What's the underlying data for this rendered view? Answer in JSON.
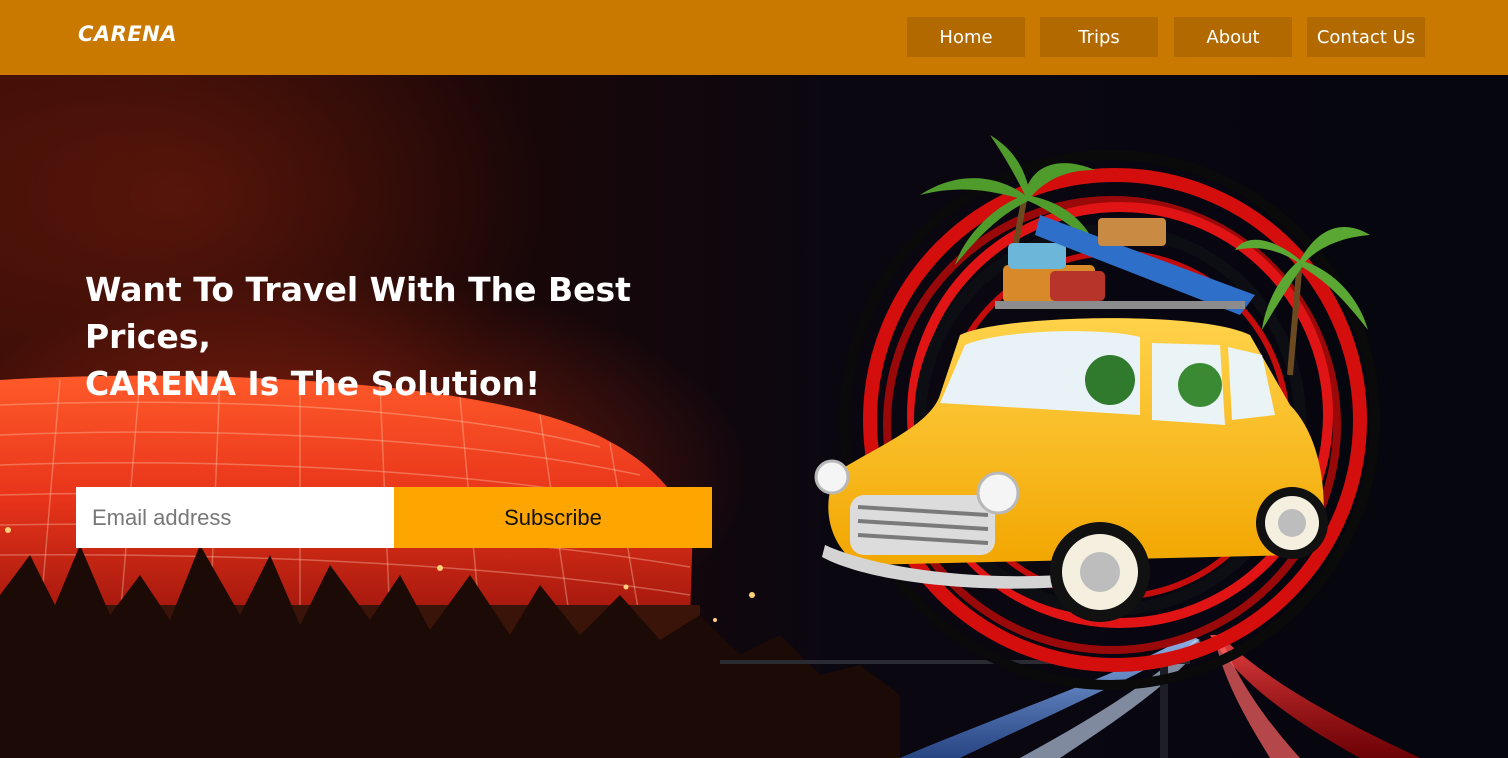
{
  "brand": {
    "logo_text": "CARENA"
  },
  "nav": {
    "items": [
      {
        "label": "Home"
      },
      {
        "label": "Trips"
      },
      {
        "label": "About"
      },
      {
        "label": "Contact Us"
      }
    ]
  },
  "hero": {
    "headline_line1": "Want To Travel With The Best Prices,",
    "headline_line2": "CARENA Is The Solution!",
    "email_placeholder": "Email address",
    "subscribe_label": "Subscribe"
  },
  "colors": {
    "navbar": "#c97800",
    "nav_button": "#b26a00",
    "subscribe_button": "#ffa500",
    "text": "#ffffff"
  },
  "icons": [
    "stadium-illustration",
    "car-illustration",
    "palm-tree-illustration"
  ]
}
